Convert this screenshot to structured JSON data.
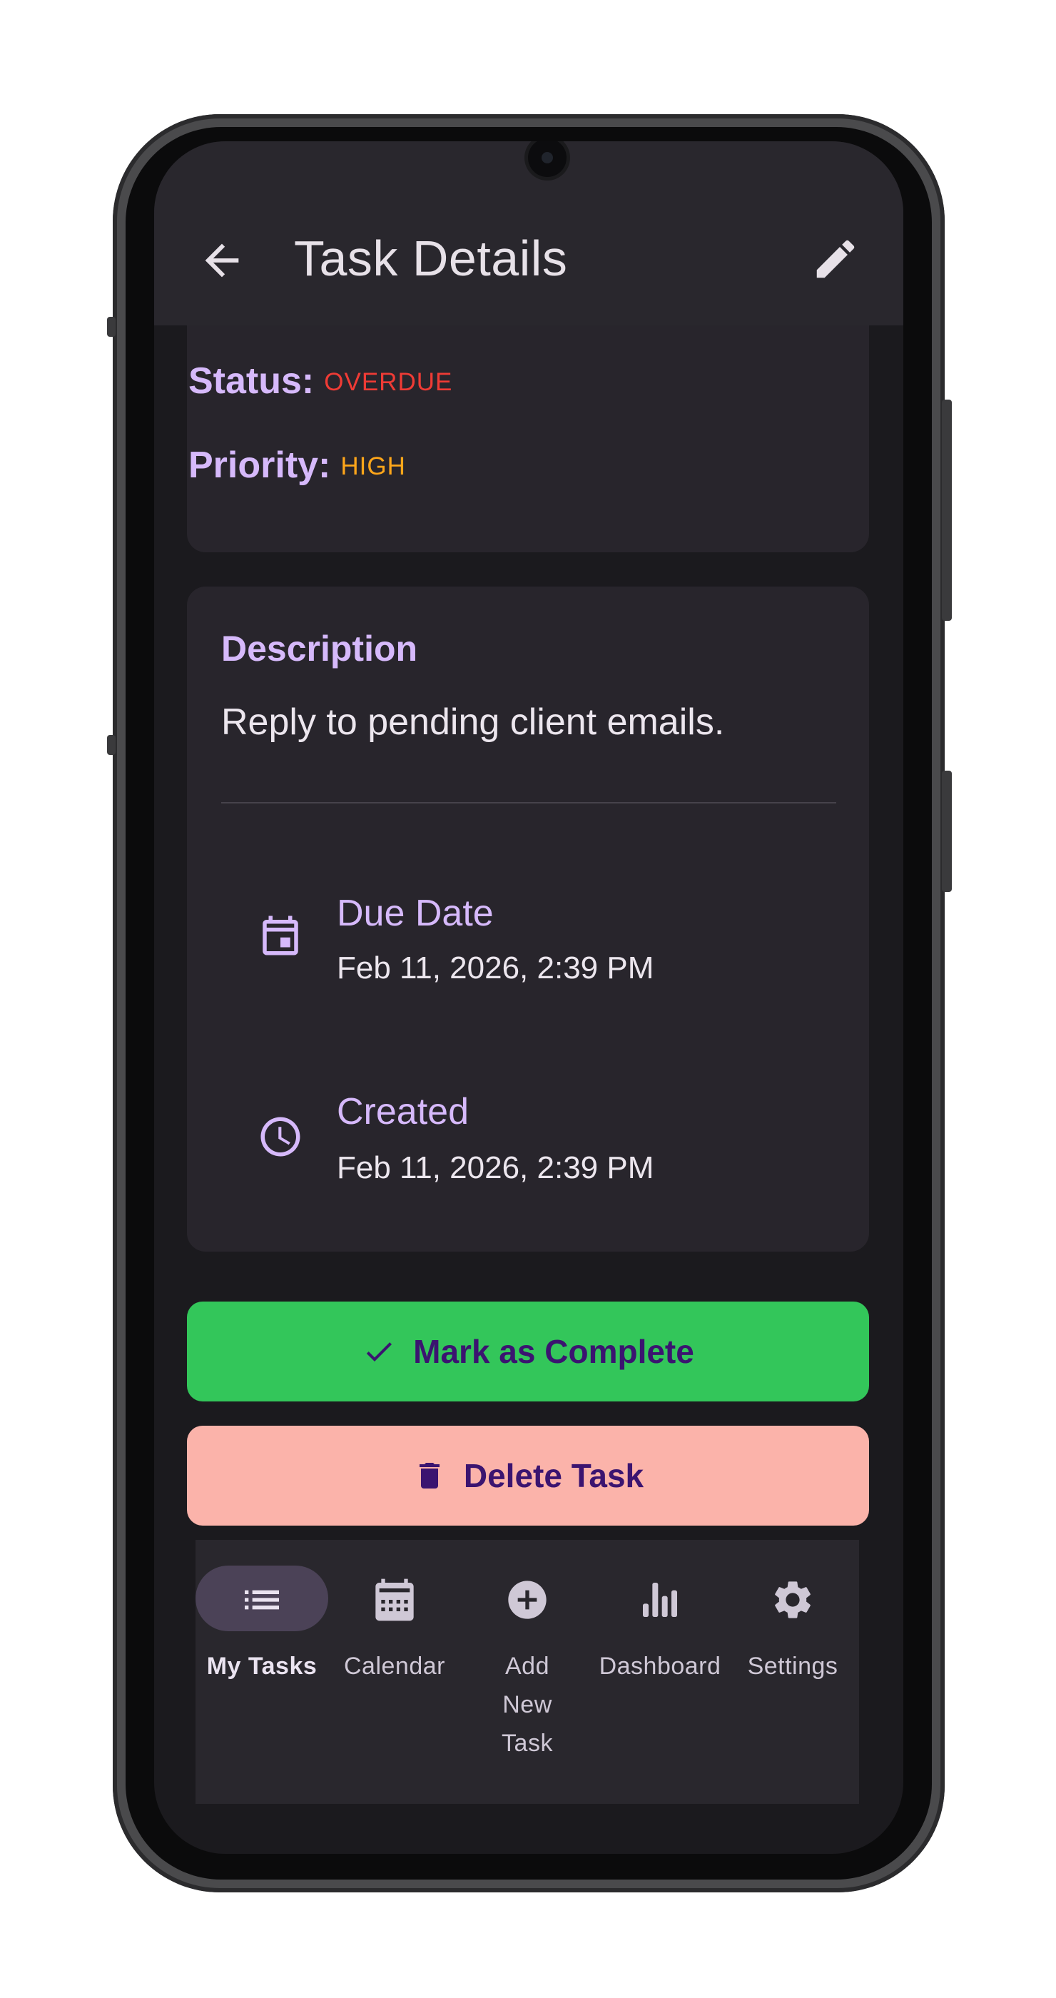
{
  "appbar": {
    "title": "Task Details"
  },
  "task": {
    "status_label": "Status:",
    "status_value": "OVERDUE",
    "priority_label": "Priority:",
    "priority_value": "HIGH",
    "description_heading": "Description",
    "description_text": "Reply to pending client emails.",
    "due_date_label": "Due Date",
    "due_date_value": "Feb 11, 2026, 2:39 PM",
    "created_label": "Created",
    "created_value": "Feb 11, 2026, 2:39 PM"
  },
  "actions": {
    "complete_label": "Mark as Complete",
    "delete_label": "Delete Task"
  },
  "nav": {
    "items": [
      {
        "label": "My Tasks",
        "icon": "list-icon",
        "active": true
      },
      {
        "label": "Calendar",
        "icon": "calendar-icon",
        "active": false
      },
      {
        "label": "Add New Task",
        "icon": "add-circle-icon",
        "active": false
      },
      {
        "label": "Dashboard",
        "icon": "bar-chart-icon",
        "active": false
      },
      {
        "label": "Settings",
        "icon": "gear-icon",
        "active": false
      }
    ]
  },
  "colors": {
    "accent_purple": "#d6b9fb",
    "overdue_red": "#ef3b35",
    "high_orange": "#ffa61a",
    "complete_green": "#33c65a",
    "delete_pink": "#fbb3aa"
  }
}
